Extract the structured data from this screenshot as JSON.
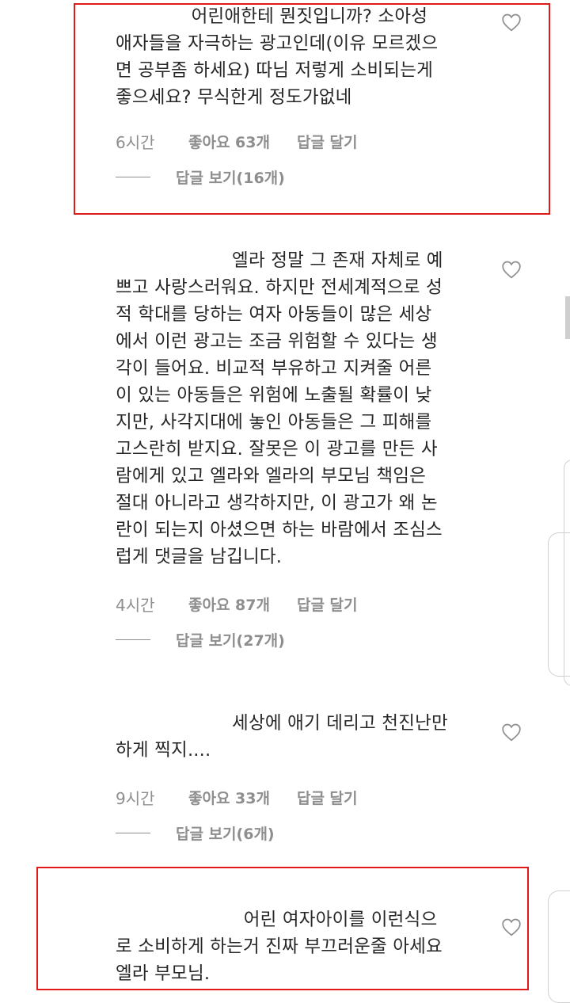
{
  "comments": [
    {
      "text": "             어린애한테 뭔짓입니까? 소아성\n애자들을 자극하는 광고인데(이유 모르겠으\n면 공부좀 하세요) 따님 저렇게 소비되는게\n좋으세요? 무식한게 정도가없네",
      "time": "6시간",
      "likes": "좋아요 63개",
      "reply": "답글 달기",
      "view_replies": "답글 보기(16개)"
    },
    {
      "text": "                    엘라 정말 그 존재 자체로 예\n쁘고 사랑스러워요. 하지만 전세계적으로 성\n적 학대를 당하는 여자 아동들이 많은 세상\n에서 이런 광고는 조금 위험할 수 있다는 생\n각이 들어요. 비교적 부유하고 지켜줄 어른\n이 있는 아동들은 위험에 노출될 확률이 낮\n지만, 사각지대에 놓인 아동들은 그 피해를\n고스란히 받지요. 잘못은 이 광고를 만든 사\n람에게 있고 엘라와 엘라의 부모님 책임은\n절대 아니라고 생각하지만, 이 광고가 왜 논\n란이 되는지 아셨으면 하는 바람에서 조심스\n럽게 댓글을 남깁니다.",
      "time": "4시간",
      "likes": "좋아요 87개",
      "reply": "답글 달기",
      "view_replies": "답글 보기(27개)"
    },
    {
      "text": "                    세상에 애기 데리고 천진난만\n하게 찍지....",
      "time": "9시간",
      "likes": "좋아요 33개",
      "reply": "답글 달기",
      "view_replies": "답글 보기(6개)"
    },
    {
      "text": "                      어린 여자아이를 이런식으\n로 소비하게 하는거 진짜 부끄러운줄 아세요\n엘라 부모님."
    }
  ],
  "colors": {
    "text": "#262626",
    "meta": "#8e8e8e",
    "highlight_border": "#e01919"
  },
  "icons": {
    "like": "heart-outline-icon"
  }
}
